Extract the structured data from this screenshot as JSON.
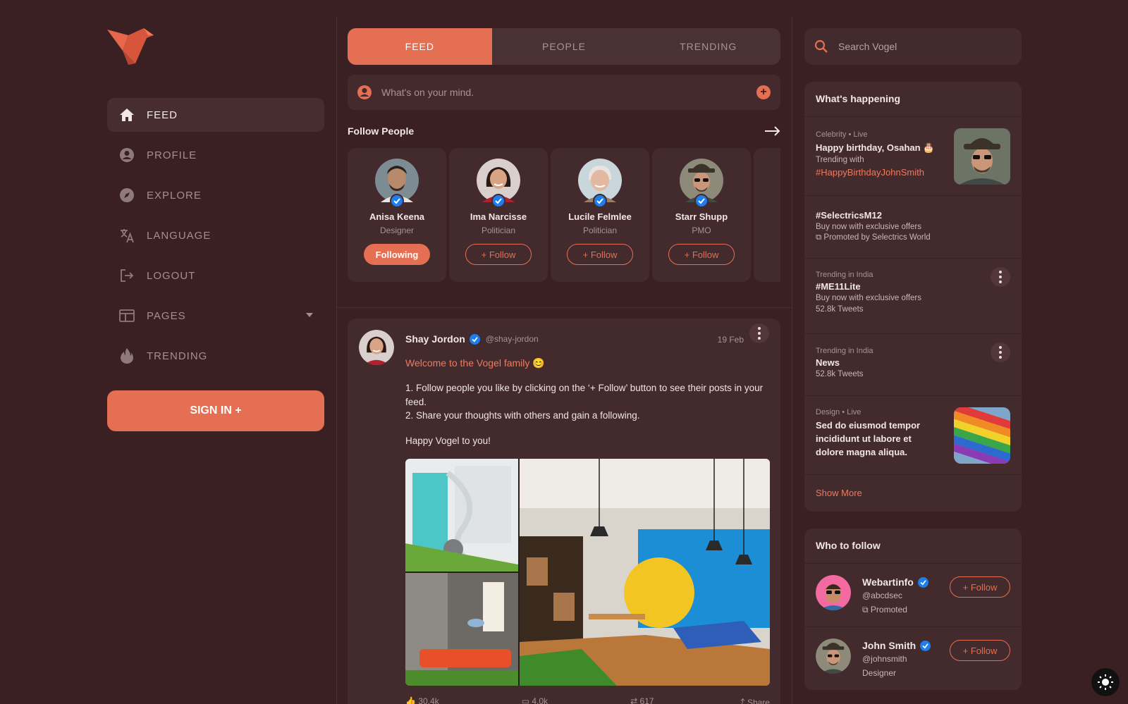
{
  "sidebar": {
    "logo_icon": "bird-logo-icon",
    "items": [
      {
        "label": "FEED",
        "icon": "home-icon",
        "active": true
      },
      {
        "label": "PROFILE",
        "icon": "user-circle-icon"
      },
      {
        "label": "EXPLORE",
        "icon": "compass-icon"
      },
      {
        "label": "LANGUAGE",
        "icon": "translate-icon"
      },
      {
        "label": "LOGOUT",
        "icon": "logout-icon"
      },
      {
        "label": "PAGES",
        "icon": "browser-window-icon",
        "dropdown": true
      },
      {
        "label": "TRENDING",
        "icon": "flame-icon"
      }
    ],
    "signin_label": "SIGN IN +"
  },
  "tabs": [
    "FEED",
    "PEOPLE",
    "TRENDING"
  ],
  "composer": {
    "placeholder": "What's on your mind."
  },
  "follow_people": {
    "title": "Follow People",
    "people": [
      {
        "name": "Anisa Keena",
        "role": "Designer",
        "button": "Following"
      },
      {
        "name": "Ima Narcisse",
        "role": "Politician",
        "button": "+ Follow"
      },
      {
        "name": "Lucile Felmlee",
        "role": "Politician",
        "button": "+ Follow"
      },
      {
        "name": "Starr Shupp",
        "role": "PMO",
        "button": "+ Follow"
      }
    ]
  },
  "post": {
    "author": "Shay Jordon",
    "handle": "@shay-jordon",
    "date": "19 Feb",
    "welcome": "Welcome to the Vogel family 😊",
    "line1": "1. Follow people you like by clicking on the ‘+ Follow’ button to see their posts in your feed.",
    "line2": "2. Share your thoughts with others and gain a following.",
    "line3": "Happy Vogel to you!",
    "likes": "30.4k",
    "comments": "4.0k",
    "shares": "617",
    "share_label": "Share"
  },
  "search": {
    "placeholder": "Search Vogel"
  },
  "happening": {
    "title": "What's happening",
    "items": [
      {
        "meta": "Celebrity • Live",
        "title": "Happy birthday, Osahan 🎂",
        "sub": "Trending with",
        "tag": "#HappyBirthdayJohnSmith"
      },
      {
        "title": "#SelectricsM12",
        "sub": "Buy now with exclusive offers",
        "promo": "Promoted by Selectrics World"
      },
      {
        "meta": "Trending in India",
        "title": "#ME11Lite",
        "sub": "Buy now with exclusive offers",
        "count": "52.8k Tweets"
      },
      {
        "meta": "Trending in India",
        "title": "News",
        "count": "52.8k Tweets"
      },
      {
        "meta": "Design • Live",
        "title": "Sed do eiusmod tempor incididunt ut labore et dolore magna aliqua."
      }
    ],
    "show_more": "Show More"
  },
  "who_to_follow": {
    "title": "Who to follow",
    "users": [
      {
        "name": "Webartinfo",
        "handle": "@abcdsec",
        "sub": "Promoted",
        "button": "+ Follow"
      },
      {
        "name": "John Smith",
        "handle": "@johnsmith",
        "sub": "Designer",
        "button": "+ Follow"
      }
    ]
  },
  "colors": {
    "accent": "#e46f52",
    "background": "#3a2022",
    "card": "#432a2d",
    "verified": "#1e7ef0"
  }
}
